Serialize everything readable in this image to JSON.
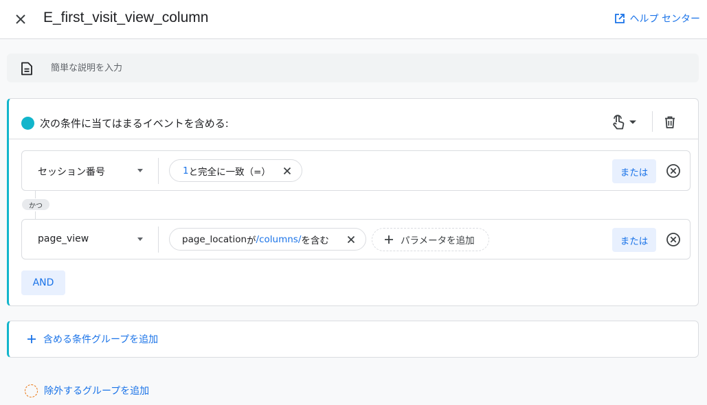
{
  "header": {
    "title": "E_first_visit_view_column",
    "help_label": "ヘルプ センター"
  },
  "description": {
    "placeholder": "簡単な説明を入力"
  },
  "include_group": {
    "title": "次の条件に当てはまるイベントを含める:",
    "accent_color": "#12b5cb",
    "conditions": [
      {
        "event": "セッション番号",
        "chip": {
          "value": "1",
          "text": " と完全に一致（=）"
        },
        "or_label": "または"
      },
      {
        "event": "page_view",
        "chip": {
          "param": "page_location",
          "op": " が ",
          "value": "/columns/",
          "suffix": " を含む"
        },
        "add_param_label": "パラメータを追加",
        "or_label": "または"
      }
    ],
    "and_connector": "かつ",
    "and_button": "AND"
  },
  "add_include_group_label": "含める条件グループを追加",
  "add_exclude_group_label": "除外するグループを追加",
  "colors": {
    "accent_blue": "#1a73e8",
    "teal": "#12b5cb",
    "exclude_orange": "#e8710a"
  }
}
